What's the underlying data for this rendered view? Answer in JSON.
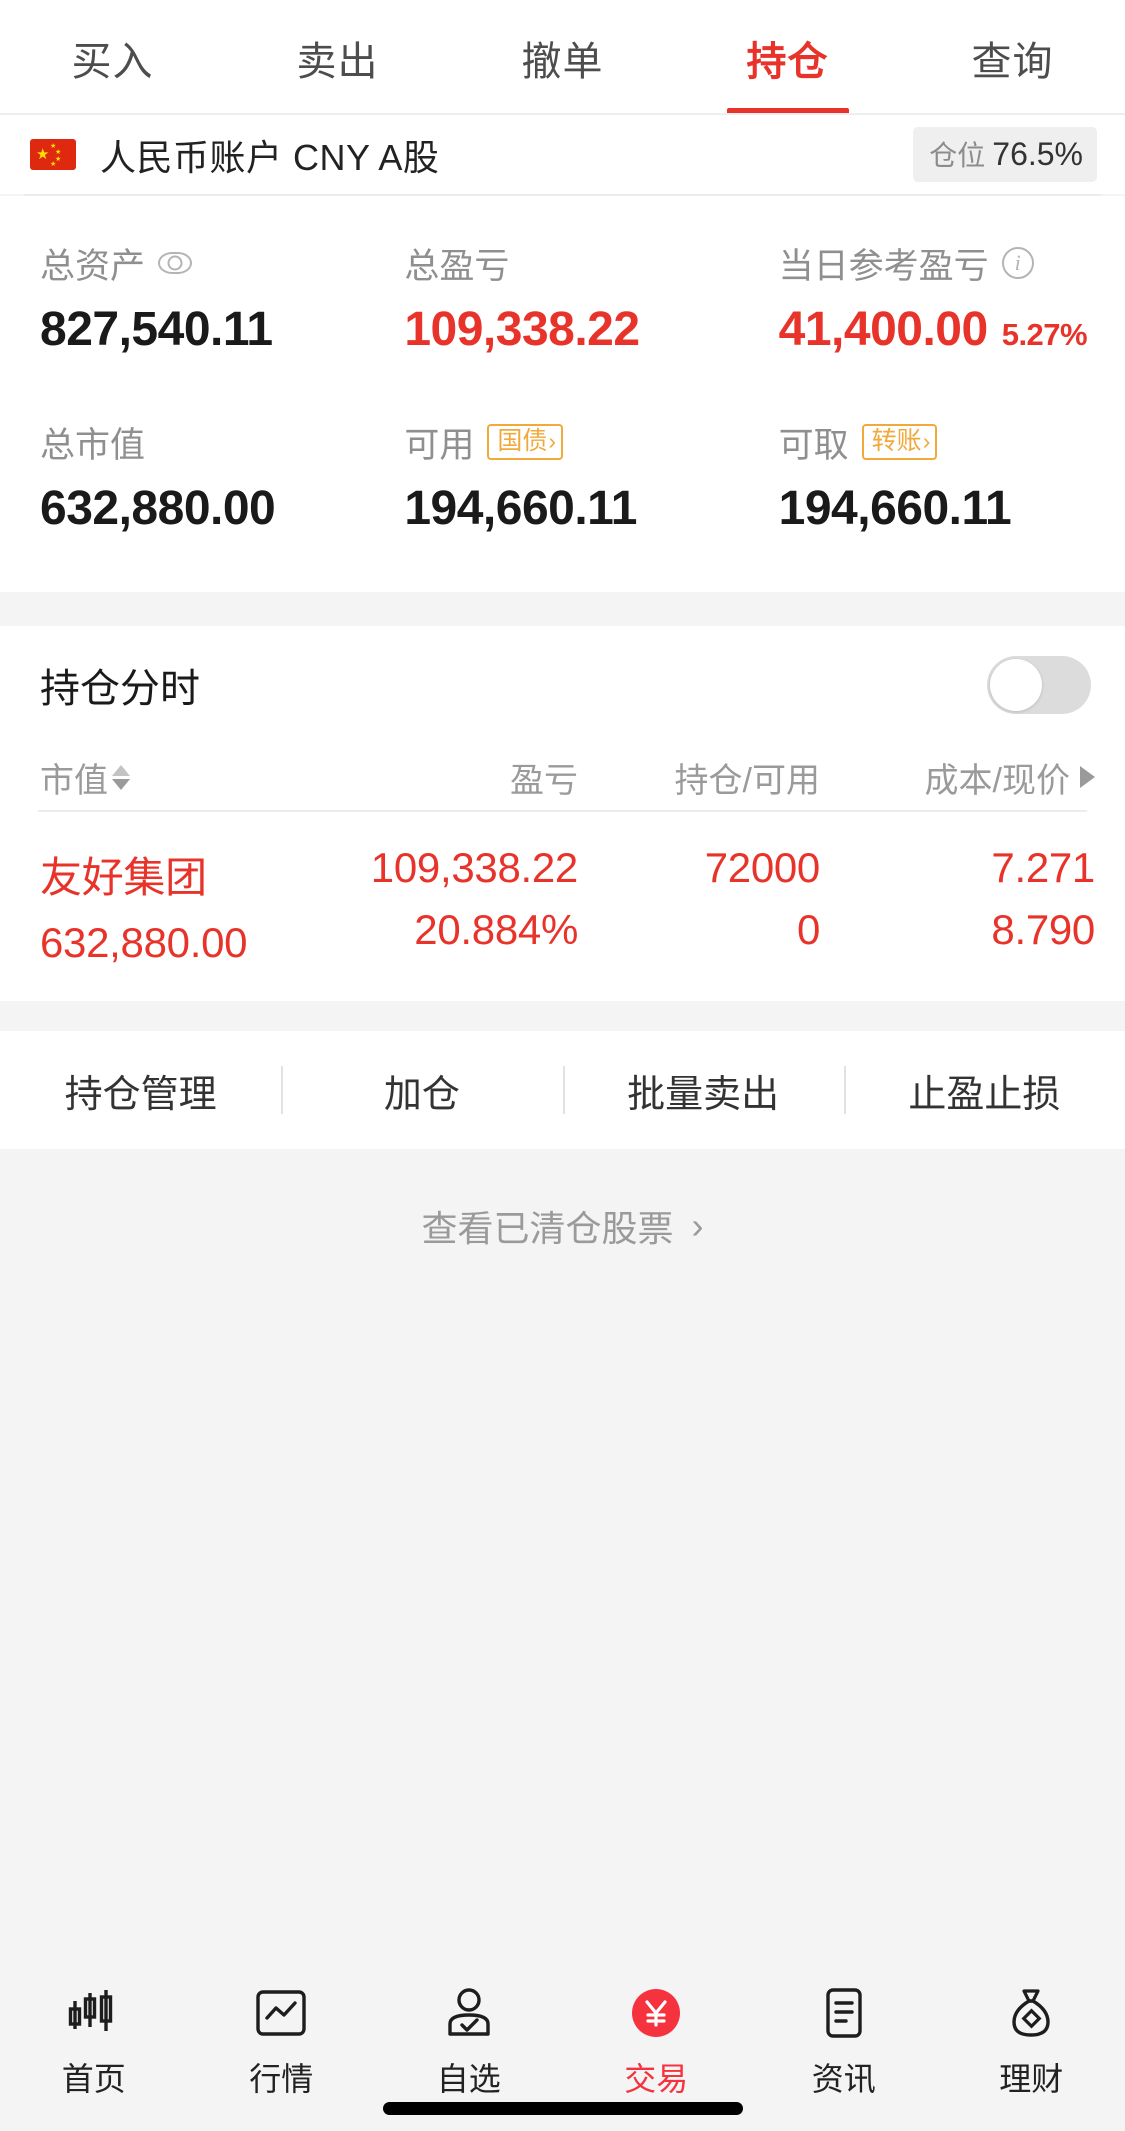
{
  "tabs": [
    {
      "label": "买入",
      "active": false
    },
    {
      "label": "卖出",
      "active": false
    },
    {
      "label": "撤单",
      "active": false
    },
    {
      "label": "持仓",
      "active": true
    },
    {
      "label": "查询",
      "active": false
    }
  ],
  "account": {
    "flag_icon": "china-flag-icon",
    "name": "人民币账户 CNY A股",
    "position_badge_label": "仓位",
    "position_badge_value": "76.5%"
  },
  "summary": {
    "row1": [
      {
        "label": "总资产",
        "icon": "eye-icon",
        "value": "827,540.11",
        "value_color": "#1a1a1a",
        "percent": ""
      },
      {
        "label": "总盈亏",
        "icon": "",
        "value": "109,338.22",
        "value_color": "#e8332a",
        "percent": ""
      },
      {
        "label": "当日参考盈亏",
        "icon": "info-icon",
        "value": "41,400.00",
        "value_color": "#e8332a",
        "percent": "5.27%"
      }
    ],
    "row2": [
      {
        "label": "总市值",
        "tag": "",
        "value": "632,880.00",
        "value_color": "#1a1a1a"
      },
      {
        "label": "可用",
        "tag": "国债",
        "value": "194,660.11",
        "value_color": "#1a1a1a"
      },
      {
        "label": "可取",
        "tag": "转账",
        "value": "194,660.11",
        "value_color": "#1a1a1a"
      }
    ]
  },
  "holdings": {
    "title": "持仓分时",
    "toggle_on": false,
    "headers": {
      "market_value": "市值",
      "profit_loss": "盈亏",
      "position_available": "持仓/可用",
      "cost_price": "成本/现价"
    },
    "rows": [
      {
        "name": "友好集团",
        "market_value": "632,880.00",
        "profit_loss": "109,338.22",
        "profit_loss_pct": "20.884%",
        "position": "72000",
        "available": "0",
        "cost": "7.271",
        "price": "8.790",
        "color": "#e8332a"
      }
    ]
  },
  "actions": [
    {
      "label": "持仓管理"
    },
    {
      "label": "加仓"
    },
    {
      "label": "批量卖出"
    },
    {
      "label": "止盈止损"
    }
  ],
  "cleared": {
    "label": "查看已清仓股票",
    "chevron": "›"
  },
  "bottom_nav": [
    {
      "label": "首页",
      "icon": "candlestick-icon",
      "active": false
    },
    {
      "label": "行情",
      "icon": "chart-box-icon",
      "active": false
    },
    {
      "label": "自选",
      "icon": "person-check-icon",
      "active": false
    },
    {
      "label": "交易",
      "icon": "yuan-circle-icon",
      "active": true
    },
    {
      "label": "资讯",
      "icon": "document-icon",
      "active": false
    },
    {
      "label": "理财",
      "icon": "money-bag-icon",
      "active": false
    }
  ],
  "colors": {
    "accent_red": "#e8332a",
    "nav_active_red": "#f5333f",
    "tag_orange": "#f2a93b",
    "muted_gray": "#8f8f8f",
    "page_bg": "#f4f4f4"
  }
}
